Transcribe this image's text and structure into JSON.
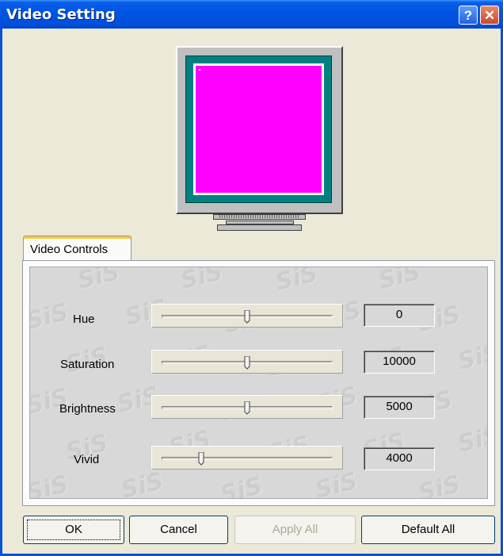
{
  "window": {
    "title": "Video Setting",
    "help_glyph": "?",
    "close_glyph": "✕"
  },
  "preview": {
    "screen_color": "#ff00ff"
  },
  "tabs": [
    {
      "label": "Video Controls"
    }
  ],
  "watermark": "SiS",
  "controls": [
    {
      "label": "Hue",
      "value": "0",
      "slider_level": 0.5
    },
    {
      "label": "Saturation",
      "value": "10000",
      "slider_level": 0.5
    },
    {
      "label": "Brightness",
      "value": "5000",
      "slider_level": 0.5
    },
    {
      "label": "Vivid",
      "value": "4000",
      "slider_level": 0.23
    }
  ],
  "buttons": {
    "ok": "OK",
    "cancel": "Cancel",
    "apply_all": "Apply All",
    "default_all": "Default All"
  }
}
